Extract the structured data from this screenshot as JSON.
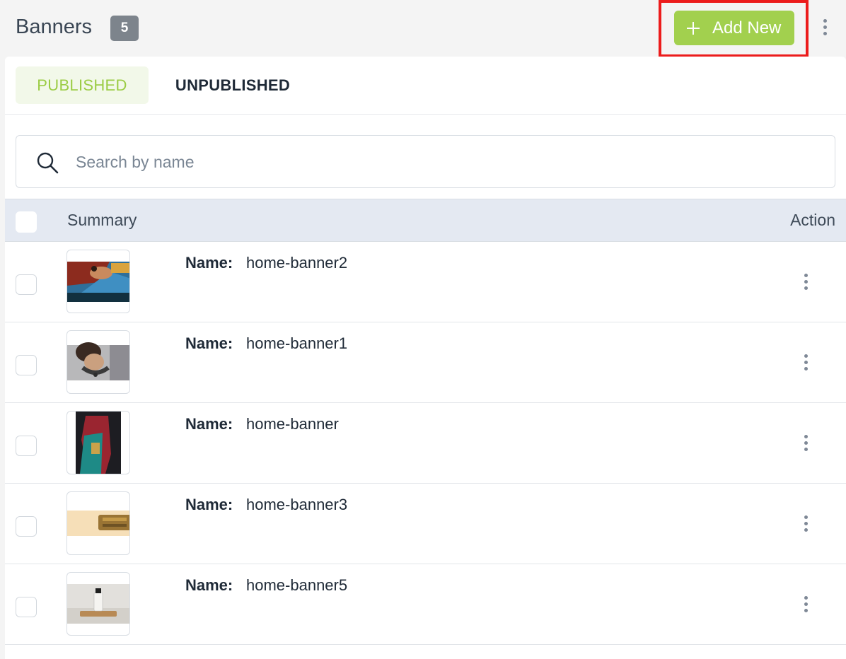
{
  "header": {
    "title": "Banners",
    "count": "5",
    "add_label": "Add New"
  },
  "tabs": [
    {
      "label": "PUBLISHED",
      "active": true
    },
    {
      "label": "UNPUBLISHED",
      "active": false
    }
  ],
  "search": {
    "placeholder": "Search by name"
  },
  "table": {
    "columns": {
      "summary": "Summary",
      "action": "Action"
    },
    "name_label": "Name:",
    "rows": [
      {
        "name": "home-banner2"
      },
      {
        "name": "home-banner1"
      },
      {
        "name": "home-banner"
      },
      {
        "name": "home-banner3"
      },
      {
        "name": "home-banner5"
      }
    ]
  },
  "colors": {
    "accent": "#a2d04e",
    "highlight": "#ec1c1c",
    "badge": "#7d848c",
    "table_header_bg": "#e4e9f2"
  },
  "icons": [
    "plus-icon",
    "kebab-menu-icon",
    "search-icon"
  ]
}
